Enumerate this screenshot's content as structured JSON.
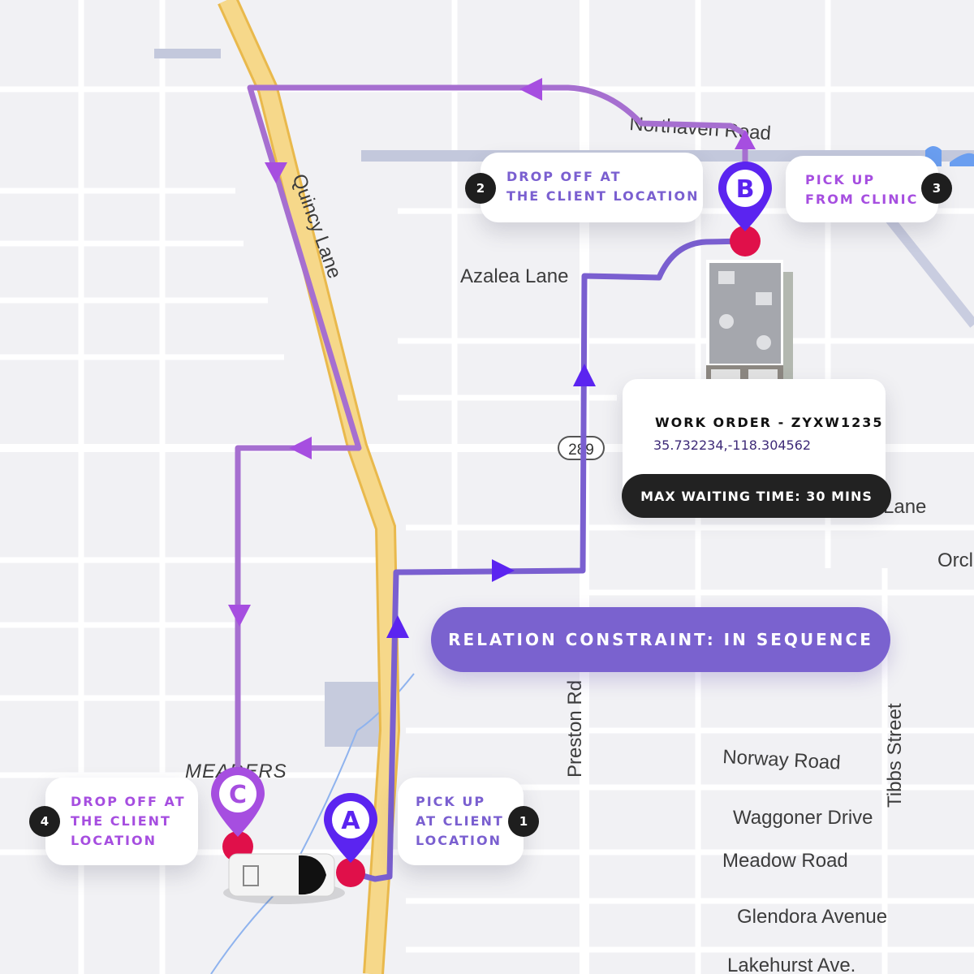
{
  "colors": {
    "route_leg_1": "#7a5fd0",
    "route_leg_2": "#a66fd0",
    "pin_a": "#5b24f0",
    "pin_b": "#5b24f0",
    "pin_c": "#a64ee0",
    "stop_dot": "#e0104a",
    "highway": "#f6d88a",
    "constraint_banner": "#7a62cf"
  },
  "streets": {
    "quincy": "Quincy Lane",
    "azalea": "Azalea Lane",
    "northaven": "Northaven Road",
    "preston": "Preston Rd",
    "norway": "Norway Road",
    "waggoner": "Waggoner Drive",
    "meadow": "Meadow Road",
    "glendora": "Glendora Avenue",
    "lakehurst": "Lakehurst Ave.",
    "tibbs": "Tibbs Street",
    "orch_partial": "Orcl",
    "lane_partial": "Lane",
    "meaders": "MEADERS",
    "route_shield": "289"
  },
  "pins": {
    "a": {
      "letter": "A",
      "icon": "map-pin"
    },
    "b": {
      "letter": "B",
      "icon": "map-pin"
    },
    "c": {
      "letter": "C",
      "icon": "map-pin"
    }
  },
  "stops": [
    {
      "number": "1",
      "label_lines": [
        "PICK UP",
        "AT CLIENT",
        "LOCATION"
      ]
    },
    {
      "number": "2",
      "label_lines": [
        "DROP OFF AT",
        "THE CLIENT LOCATION"
      ]
    },
    {
      "number": "3",
      "label_lines": [
        "PICK UP",
        "FROM CLINIC"
      ]
    },
    {
      "number": "4",
      "label_lines": [
        "DROP OFF AT",
        "THE CLIENT",
        "LOCATION"
      ]
    }
  ],
  "work_order": {
    "title": "WORK ORDER - ZYXW1235",
    "coordinates": "35.732234,-118.304562",
    "max_wait": "MAX WAITING TIME: 30 MINS",
    "icon": "clinic-building"
  },
  "constraint_banner": "RELATION CONSTRAINT: IN SEQUENCE",
  "vehicle": {
    "icon": "van"
  }
}
